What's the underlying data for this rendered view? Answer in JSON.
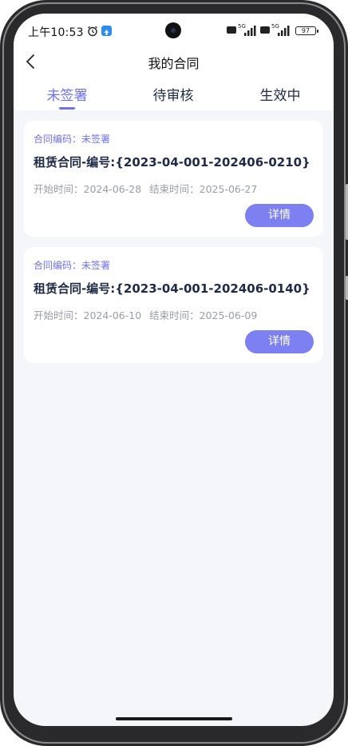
{
  "status_bar": {
    "time": "上午10:53",
    "network_1": "5G",
    "network_2": "5G",
    "battery": "97"
  },
  "header": {
    "title": "我的合同"
  },
  "tabs": [
    {
      "label": "未签署",
      "active": true
    },
    {
      "label": "待审核",
      "active": false
    },
    {
      "label": "生效中",
      "active": false
    }
  ],
  "contracts": [
    {
      "code_line": "合同编码：未签署",
      "title": "租赁合同-编号:{2023-04-001-202406-0210}",
      "start": "开始时间：2024-06-28",
      "end": "结束时间：2025-06-27",
      "detail_label": "详情"
    },
    {
      "code_line": "合同编码：未签署",
      "title": "租赁合同-编号:{2023-04-001-202406-0140}",
      "start": "开始时间：2024-06-10",
      "end": "结束时间：2025-06-09",
      "detail_label": "详情"
    }
  ],
  "colors": {
    "accent": "#6f73ee",
    "button": "#7c80f0",
    "background": "#f5f6fa"
  }
}
